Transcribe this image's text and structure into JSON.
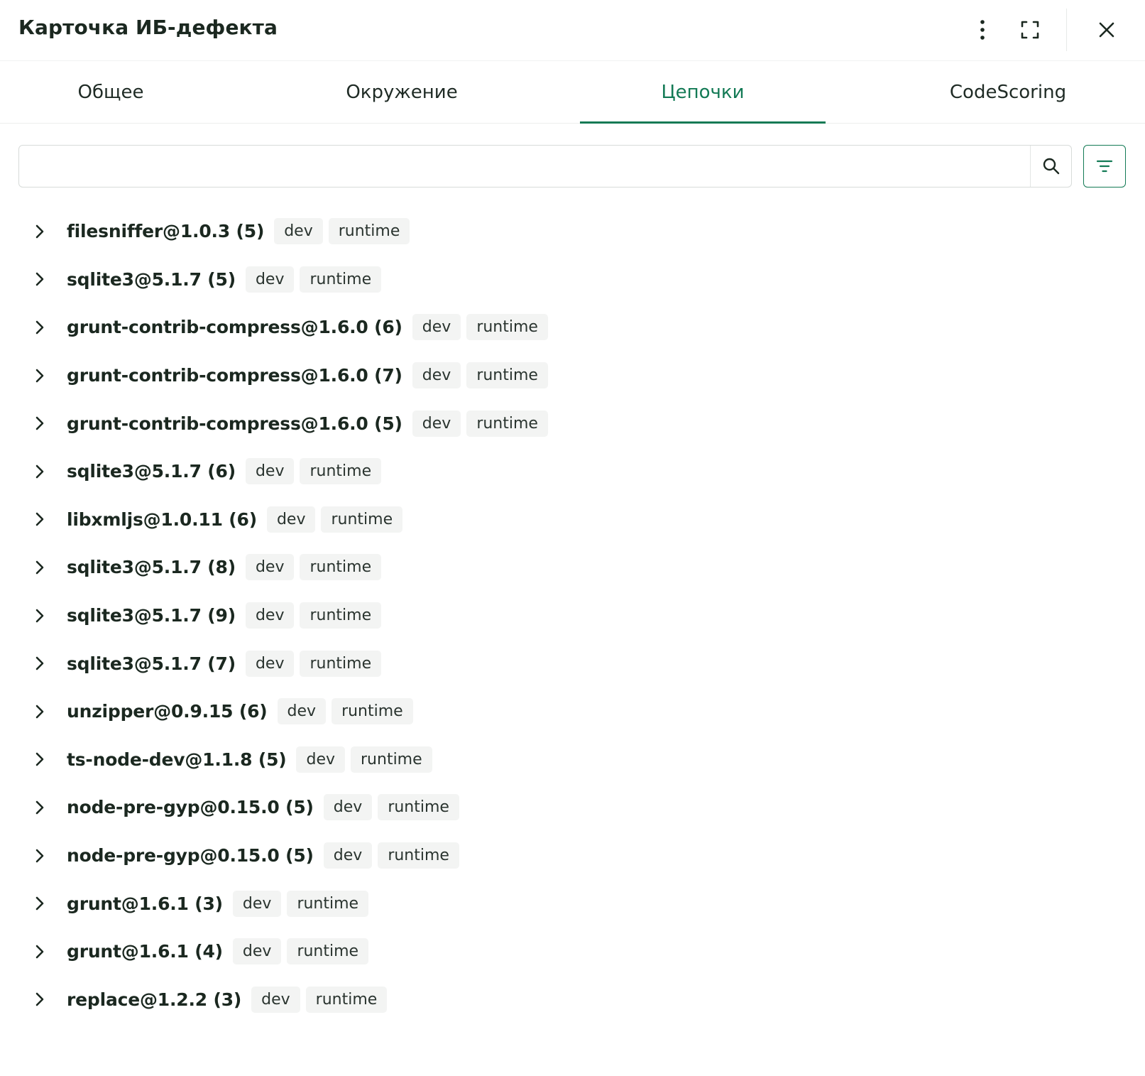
{
  "header": {
    "title": "Карточка ИБ-дефекта"
  },
  "tabs": [
    {
      "label": "Общее",
      "active": false
    },
    {
      "label": "Окружение",
      "active": false
    },
    {
      "label": "Цепочки",
      "active": true
    },
    {
      "label": "CodeScoring",
      "active": false
    }
  ],
  "search": {
    "value": "",
    "placeholder": ""
  },
  "chains": [
    {
      "name": "filesniffer@1.0.3 (5)",
      "tags": [
        "dev",
        "runtime"
      ]
    },
    {
      "name": "sqlite3@5.1.7 (5)",
      "tags": [
        "dev",
        "runtime"
      ]
    },
    {
      "name": "grunt-contrib-compress@1.6.0 (6)",
      "tags": [
        "dev",
        "runtime"
      ]
    },
    {
      "name": "grunt-contrib-compress@1.6.0 (7)",
      "tags": [
        "dev",
        "runtime"
      ]
    },
    {
      "name": "grunt-contrib-compress@1.6.0 (5)",
      "tags": [
        "dev",
        "runtime"
      ]
    },
    {
      "name": "sqlite3@5.1.7 (6)",
      "tags": [
        "dev",
        "runtime"
      ]
    },
    {
      "name": "libxmljs@1.0.11 (6)",
      "tags": [
        "dev",
        "runtime"
      ]
    },
    {
      "name": "sqlite3@5.1.7 (8)",
      "tags": [
        "dev",
        "runtime"
      ]
    },
    {
      "name": "sqlite3@5.1.7 (9)",
      "tags": [
        "dev",
        "runtime"
      ]
    },
    {
      "name": "sqlite3@5.1.7 (7)",
      "tags": [
        "dev",
        "runtime"
      ]
    },
    {
      "name": "unzipper@0.9.15 (6)",
      "tags": [
        "dev",
        "runtime"
      ]
    },
    {
      "name": "ts-node-dev@1.1.8 (5)",
      "tags": [
        "dev",
        "runtime"
      ]
    },
    {
      "name": "node-pre-gyp@0.15.0 (5)",
      "tags": [
        "dev",
        "runtime"
      ]
    },
    {
      "name": "node-pre-gyp@0.15.0 (5)",
      "tags": [
        "dev",
        "runtime"
      ]
    },
    {
      "name": "grunt@1.6.1 (3)",
      "tags": [
        "dev",
        "runtime"
      ]
    },
    {
      "name": "grunt@1.6.1 (4)",
      "tags": [
        "dev",
        "runtime"
      ]
    },
    {
      "name": "replace@1.2.2 (3)",
      "tags": [
        "dev",
        "runtime"
      ]
    }
  ],
  "icons": {
    "more": "more-vertical-icon",
    "expand": "fullscreen-icon",
    "close": "close-icon",
    "search": "search-icon",
    "filter": "filter-icon",
    "chevron": "chevron-right-icon"
  },
  "colors": {
    "accent": "#137a55",
    "text": "#1b2820",
    "tag_bg": "#f3f4f3",
    "border": "#d7dbd9"
  }
}
